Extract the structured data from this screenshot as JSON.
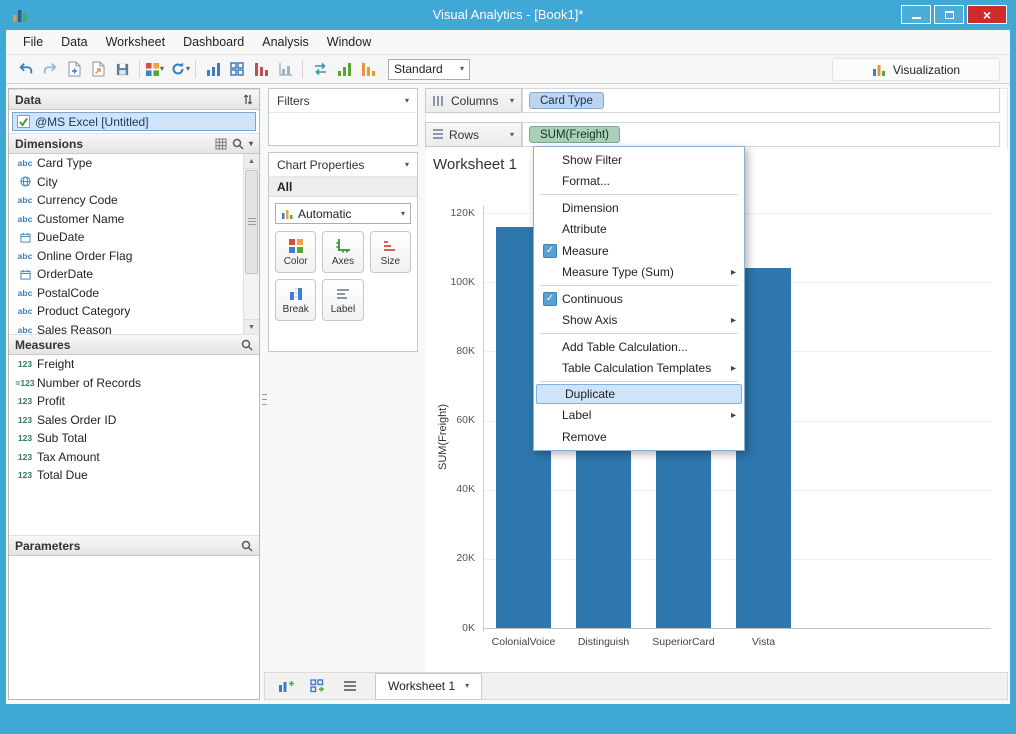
{
  "window": {
    "title": "Visual Analytics - [Book1]*"
  },
  "menubar": {
    "items": [
      "File",
      "Data",
      "Worksheet",
      "Dashboard",
      "Analysis",
      "Window"
    ]
  },
  "toolbar": {
    "view_mode": "Standard",
    "visualization_label": "Visualization"
  },
  "data_panel": {
    "header": "Data",
    "source": "@MS Excel [Untitled]",
    "dimensions": {
      "header": "Dimensions",
      "items": [
        {
          "icon": "abc",
          "label": "Card Type"
        },
        {
          "icon": "globe",
          "label": "City"
        },
        {
          "icon": "abc",
          "label": "Currency Code"
        },
        {
          "icon": "abc",
          "label": "Customer Name"
        },
        {
          "icon": "date",
          "label": "DueDate"
        },
        {
          "icon": "abc",
          "label": "Online Order Flag"
        },
        {
          "icon": "date",
          "label": "OrderDate"
        },
        {
          "icon": "abc",
          "label": "PostalCode"
        },
        {
          "icon": "abc",
          "label": "Product Category"
        },
        {
          "icon": "abc",
          "label": "Sales Reason"
        }
      ]
    },
    "measures": {
      "header": "Measures",
      "items": [
        {
          "icon": "123",
          "label": "Freight"
        },
        {
          "icon": "=123",
          "label": "Number of Records"
        },
        {
          "icon": "123",
          "label": "Profit"
        },
        {
          "icon": "123",
          "label": "Sales Order ID"
        },
        {
          "icon": "123",
          "label": "Sub Total"
        },
        {
          "icon": "123",
          "label": "Tax Amount"
        },
        {
          "icon": "123",
          "label": "Total Due"
        }
      ]
    },
    "parameters": {
      "header": "Parameters"
    }
  },
  "filters_panel": {
    "header": "Filters"
  },
  "chart_properties": {
    "header": "Chart Properties",
    "scope": "All",
    "mark_type": "Automatic",
    "buttons": [
      "Color",
      "Axes",
      "Size",
      "Break",
      "Label"
    ]
  },
  "shelves": {
    "columns_label": "Columns",
    "rows_label": "Rows",
    "columns_pills": [
      "Card Type"
    ],
    "rows_pills": [
      "SUM(Freight)"
    ]
  },
  "worksheet": {
    "title": "Worksheet 1",
    "tab": "Worksheet 1"
  },
  "context_menu": {
    "items": [
      {
        "label": "Show Filter"
      },
      {
        "label": "Format..."
      },
      {
        "separator": true
      },
      {
        "label": "Dimension"
      },
      {
        "label": "Attribute"
      },
      {
        "label": "Measure",
        "checked": true
      },
      {
        "label": "Measure Type (Sum)",
        "submenu": true
      },
      {
        "separator": true
      },
      {
        "label": "Continuous",
        "checked": true
      },
      {
        "label": "Show Axis",
        "submenu": true
      },
      {
        "separator": true
      },
      {
        "label": "Add Table Calculation..."
      },
      {
        "label": "Table Calculation Templates",
        "submenu": true
      },
      {
        "separator": true
      },
      {
        "label": "Duplicate",
        "highlighted": true
      },
      {
        "label": "Label",
        "submenu": true
      },
      {
        "label": "Remove"
      }
    ]
  },
  "chart_data": {
    "type": "bar",
    "title": "Worksheet 1",
    "categories": [
      "ColonialVoice",
      "Distinguish",
      "SuperiorCard",
      "Vista"
    ],
    "values": [
      116,
      92,
      100,
      104
    ],
    "unit": "K",
    "ylabel": "SUM(Freight)",
    "yticks": [
      "0K",
      "20K",
      "40K",
      "60K",
      "80K",
      "100K",
      "120K"
    ],
    "ylim": [
      0,
      120
    ],
    "grid": false,
    "legend": false,
    "bar_color": "#2d77ae"
  },
  "colors": {
    "titlebar": "#3fa8d5",
    "dimension_pill": "#bdd5ef",
    "measure_pill": "#abd0ba",
    "bar": "#2d77ae",
    "menu_highlight": "#cde4f9",
    "close_button": "#ce2b2b"
  }
}
